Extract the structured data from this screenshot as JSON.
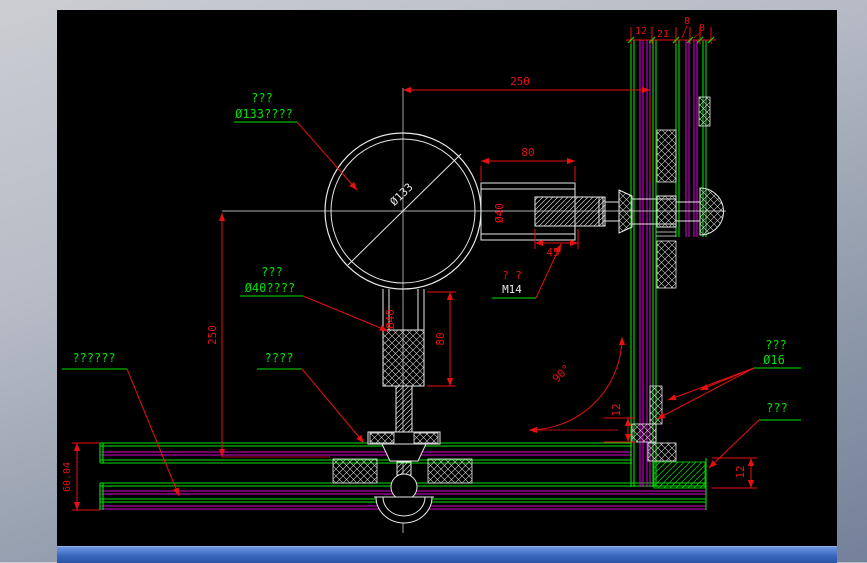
{
  "window": {
    "canvas_bg": "#000000",
    "frame_top_color": "#cbcdd2",
    "frame_bottom_color": "#74819a",
    "scrollbar_color": "#3a67bd"
  },
  "colors": {
    "outline_white": "#e8e8e8",
    "profile_green": "#00e000",
    "profile_magenta": "#d000d0",
    "dimension_red": "#e81010",
    "label_green": "#00e000"
  },
  "labels": {
    "note_circle": {
      "line1": "???",
      "line2": "Ø133????"
    },
    "note_bolt": {
      "line1": "???",
      "line2": "Ø40????"
    },
    "note_left": "??????",
    "note_mid": "????",
    "note_anchor": {
      "line1": "???",
      "line2": "Ø16"
    },
    "note_right": "???",
    "thread_marks": "?  ?",
    "thread": "M14",
    "dia_circle": "Ø133",
    "dia_rod": "Ø40",
    "dia_shaft": "Ø40"
  },
  "dims": {
    "span_top": "250",
    "span_left": "250",
    "sleeve": "80",
    "shaft": "80",
    "tip": "45",
    "angle": "90°",
    "rail_h": "60.04",
    "gap_mid": "12",
    "gap_right": "12",
    "top_12": "12",
    "top_21": "21",
    "top_8a": "8",
    "top_8b": "8"
  }
}
